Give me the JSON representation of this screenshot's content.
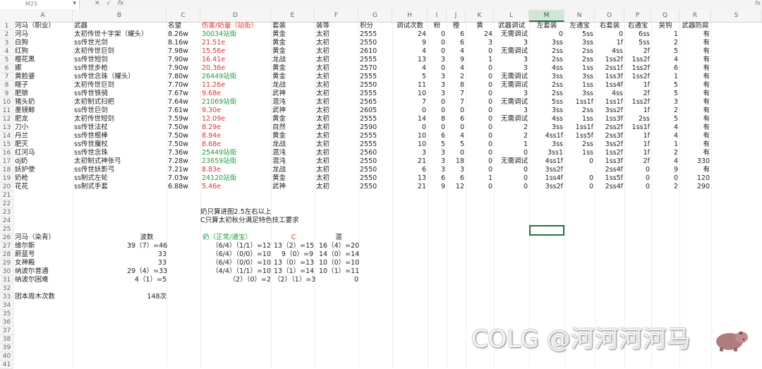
{
  "toolbar": {
    "name_box": "M25",
    "fx_cancel": "✕",
    "fx_confirm": "✓",
    "fx_label": "fx",
    "formula_right": "fx"
  },
  "columns": [
    "A",
    "B",
    "C",
    "D",
    "E",
    "F",
    "G",
    "H",
    "I",
    "J",
    "K",
    "L",
    "M",
    "N",
    "O",
    "P",
    "Q",
    "R",
    "S"
  ],
  "selected_column": "M",
  "rows": [
    [
      "河马（职业）",
      "武器",
      "名望",
      "伤害/奶量（站街）",
      "套装",
      "装等",
      "积分",
      "调试次数",
      "粉",
      "橙",
      "黄",
      "武器调试",
      "左套装",
      "左通宝",
      "右套装",
      "右通宝",
      "吴钩",
      "武器防腐"
    ],
    [
      "河马",
      "太初传世十字架（耀头）",
      "8.26w",
      "30034站街",
      "黄金",
      "太初",
      "2555",
      "24",
      "0",
      "6",
      "24",
      "无需调试",
      "0",
      "5ss",
      "0",
      "6ss",
      "1",
      "有"
    ],
    [
      "白狗",
      "ss传世光剑",
      "8.16w",
      "21.51e",
      "黄金",
      "太初",
      "2550",
      "9",
      "0",
      "6",
      "3",
      "3",
      "3ss",
      "3ss",
      "1f",
      "5ss",
      "2",
      "有"
    ],
    [
      "红狗",
      "太初传世巨剑",
      "7.98w",
      "15.56e",
      "黄金",
      "太初",
      "2610",
      "4",
      "0",
      "4",
      "0",
      "无需调试",
      "2ss",
      "2ss",
      "4ss",
      "2f",
      "5",
      "有"
    ],
    [
      "樱花黑",
      "ss传世短剑",
      "7.90w",
      "16.41e",
      "龙战",
      "太初",
      "2555",
      "13",
      "3",
      "9",
      "1",
      "3",
      "2ss",
      "2ss",
      "1ss2f",
      "1ss2f",
      "4",
      "有"
    ],
    [
      "娜",
      "ss传世步枪",
      "7.90w",
      "20.36e",
      "黄金",
      "太初",
      "2570",
      "4",
      "0",
      "4",
      "0",
      "3",
      "4ss",
      "1ss",
      "2ss1f",
      "1ss2f",
      "6",
      "有"
    ],
    [
      "黄脸婆",
      "ss传世念珠（耀头）",
      "7.80w",
      "26449站街",
      "黄金",
      "太初",
      "2555",
      "5",
      "3",
      "2",
      "0",
      "无需调试",
      "3ss",
      "3ss",
      "1ss3f",
      "1ss2f",
      "1",
      "有"
    ],
    [
      "瞎子",
      "太初传世巨剑",
      "7.70w",
      "11.26e",
      "龙战",
      "太初",
      "2550",
      "11",
      "3",
      "8",
      "0",
      "无需调试",
      "2ss",
      "1ss",
      "1ss4f",
      "1f",
      "5",
      "有"
    ],
    [
      "肥狼",
      "ss传世铁骑",
      "7.67w",
      "9.68e",
      "武神",
      "太初",
      "2555",
      "10",
      "3",
      "7",
      "0",
      "3",
      "2ss",
      "3ss",
      "4ss",
      "2f",
      "5",
      "有"
    ],
    [
      "猪头奶",
      "太初制式扫把",
      "7.64w",
      "21069站街",
      "混沌",
      "太初",
      "2565",
      "7",
      "0",
      "7",
      "0",
      "无需调试",
      "5ss",
      "1ss1f",
      "1ss1f",
      "1ss2f",
      "3",
      "有"
    ],
    [
      "墨镜鲸",
      "ss传世巨剑",
      "7.61w",
      "9.30e",
      "武神",
      "太初",
      "2605",
      "0",
      "0",
      "0",
      "0",
      "3",
      "3ss",
      "2ss",
      "3ss2f",
      "1f",
      "2",
      "有"
    ],
    [
      "肥龙",
      "太初传世短剑",
      "7.59w",
      "12.09e",
      "黄金",
      "太初",
      "2555",
      "14",
      "8",
      "6",
      "0",
      "无需调试",
      "4ss",
      "1ss",
      "1ss3f",
      "2ss",
      "5",
      "有"
    ],
    [
      "刀小",
      "ss传世法杖",
      "7.50w",
      "8.29e",
      "自然",
      "太初",
      "2590",
      "0",
      "0",
      "0",
      "0",
      "2",
      "3ss",
      "1ss1f",
      "2ss2f",
      "1ss1f",
      "4",
      "有"
    ],
    [
      "丹兰",
      "ss传世棍棒",
      "7.50w",
      "8.94e",
      "黄金",
      "太初",
      "2555",
      "10",
      "6",
      "4",
      "0",
      "2",
      "4ss1f",
      "1ss5f",
      "2ss3f",
      "1f",
      "4",
      "有"
    ],
    [
      "肥灭",
      "ss传世魔杖",
      "7.50w",
      "8.68e",
      "龙战",
      "太初",
      "2555",
      "10",
      "5",
      "5",
      "0",
      "1",
      "3ss",
      "2ss",
      "3ss2f",
      "1f",
      "1",
      "有"
    ],
    [
      "红河马",
      "ss传世念珠",
      "7.36w",
      "25449站街",
      "混沌",
      "太初",
      "2560",
      "3",
      "3",
      "0",
      "0",
      "0",
      "3ss1",
      "1ss",
      "1ss2f",
      "1f",
      "2",
      "有"
    ],
    [
      "dj奶",
      "太初制式神张弓",
      "7.28w",
      "23659站街",
      "混沌",
      "太初",
      "2550",
      "21",
      "3",
      "18",
      "0",
      "无需调试",
      "4ss1f",
      "0",
      "1ss3f",
      "2f",
      "4",
      "330"
    ],
    [
      "妖护使",
      "ss传世妖影弓",
      "7.21w",
      "8.83e",
      "龙战",
      "太初",
      "2550",
      "6",
      "3",
      "3",
      "0",
      "0",
      "3ss2f",
      "",
      "2ss4f",
      "0",
      "9",
      "有"
    ],
    [
      "奶枪",
      "ss制式左轮",
      "7.03w",
      "24120站街",
      "黄金",
      "太初",
      "2550",
      "13",
      "6",
      "6",
      "1",
      "0",
      "1ss4f",
      "0",
      "1ss5f",
      "0",
      "0",
      "120"
    ],
    [
      "花花",
      "ss制式手套",
      "6.88w",
      "5.46e",
      "武神",
      "太初",
      "2550",
      "21",
      "9",
      "12",
      "0",
      "0",
      "3ss2f",
      "0",
      "2ss4f",
      "0",
      "2",
      "290"
    ]
  ],
  "notes": [
    "奶只算进图2.5左右以上",
    "C只算太初秋分满足特色技工要求"
  ],
  "table2": {
    "headers": [
      "河马（染青）",
      "波数",
      "奶（正常/通宝）",
      "C",
      "混"
    ],
    "rows": [
      [
        "维尔斯",
        "39（7）=46",
        "（6/4）（1/1）=12",
        "13（2）=15",
        "16（4）=20"
      ],
      [
        "蔚蓝号",
        "33",
        "（6/4）（0/0）=10",
        "9（0）=9",
        "14（0）=14"
      ],
      [
        "女神殿",
        "33",
        "（6/4）（0/0）=10",
        "13（0）=13",
        "10（0）=10"
      ],
      [
        "纳波尔普通",
        "29（4）=33",
        "（4/4）（1/1）=10",
        "13（1）=14",
        "10（1）=11"
      ],
      [
        "纳波尔困难",
        "4（1）=5",
        "（2）（0）=2",
        "（2）（1）=3",
        "0"
      ]
    ],
    "footer_label": "团本周木次数",
    "footer_value": "148次"
  },
  "watermark": "COLG @河河河河马"
}
